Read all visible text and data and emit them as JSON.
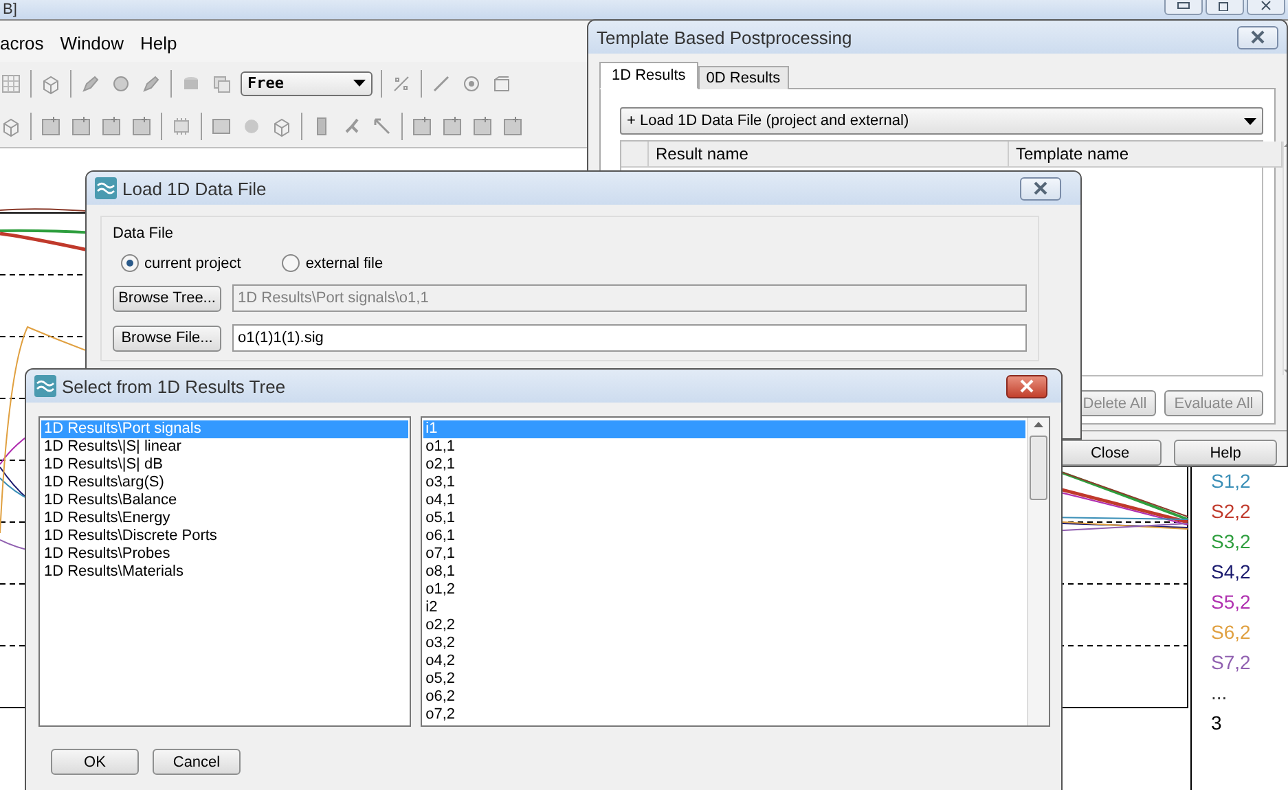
{
  "app": {
    "title_fragment": "B]",
    "menu": [
      "acros",
      "Window",
      "Help"
    ],
    "toolbar": {
      "view_mode": "Free"
    }
  },
  "plot": {
    "legend": [
      {
        "label": "S1,2",
        "color": "#3a8fb7"
      },
      {
        "label": "S2,2",
        "color": "#c0392b"
      },
      {
        "label": "S3,2",
        "color": "#2e9e3e"
      },
      {
        "label": "S4,2",
        "color": "#1a1a6e"
      },
      {
        "label": "S5,2",
        "color": "#b030b0"
      },
      {
        "label": "S6,2",
        "color": "#e0a040"
      },
      {
        "label": "S7,2",
        "color": "#9060b0"
      }
    ],
    "legend_more": "...",
    "axis_label": "3"
  },
  "template_window": {
    "title": "Template Based Postprocessing",
    "tabs": [
      {
        "label": "1D Results",
        "selected": true
      },
      {
        "label": "0D Results",
        "selected": false
      }
    ],
    "template_dropdown": "+ Load 1D Data File (project and external)",
    "table": {
      "columns": [
        "Result name",
        "Template name"
      ]
    },
    "buttons": [
      {
        "label": "Delete All",
        "disabled": true
      },
      {
        "label": "Evaluate All",
        "disabled": true
      }
    ],
    "footer_buttons": [
      "Close",
      "Help"
    ]
  },
  "load_dialog": {
    "title": "Load 1D Data File",
    "group": "Data File",
    "source_options": [
      {
        "label": "current project",
        "selected": true
      },
      {
        "label": "external file",
        "selected": false
      }
    ],
    "rows": [
      {
        "button": "Browse Tree...",
        "value": "1D Results\\Port signals\\o1,1",
        "disabled": true
      },
      {
        "button": "Browse File...",
        "value": "o1(1)1(1).sig",
        "disabled": false
      }
    ]
  },
  "select_dialog": {
    "title": "Select from 1D Results Tree",
    "folders": [
      {
        "label": "1D Results\\Port signals",
        "selected": true
      },
      {
        "label": "1D Results\\|S| linear",
        "selected": false
      },
      {
        "label": "1D Results\\|S| dB",
        "selected": false
      },
      {
        "label": "1D Results\\arg(S)",
        "selected": false
      },
      {
        "label": "1D Results\\Balance",
        "selected": false
      },
      {
        "label": "1D Results\\Energy",
        "selected": false
      },
      {
        "label": "1D Results\\Discrete Ports",
        "selected": false
      },
      {
        "label": "1D Results\\Probes",
        "selected": false
      },
      {
        "label": "1D Results\\Materials",
        "selected": false
      }
    ],
    "results": [
      {
        "label": "i1",
        "selected": true
      },
      {
        "label": "o1,1",
        "selected": false
      },
      {
        "label": "o2,1",
        "selected": false
      },
      {
        "label": "o3,1",
        "selected": false
      },
      {
        "label": "o4,1",
        "selected": false
      },
      {
        "label": "o5,1",
        "selected": false
      },
      {
        "label": "o6,1",
        "selected": false
      },
      {
        "label": "o7,1",
        "selected": false
      },
      {
        "label": "o8,1",
        "selected": false
      },
      {
        "label": "o1,2",
        "selected": false
      },
      {
        "label": "i2",
        "selected": false
      },
      {
        "label": "o2,2",
        "selected": false
      },
      {
        "label": "o3,2",
        "selected": false
      },
      {
        "label": "o4,2",
        "selected": false
      },
      {
        "label": "o5,2",
        "selected": false
      },
      {
        "label": "o6,2",
        "selected": false
      },
      {
        "label": "o7,2",
        "selected": false
      }
    ],
    "buttons": [
      "OK",
      "Cancel"
    ]
  }
}
